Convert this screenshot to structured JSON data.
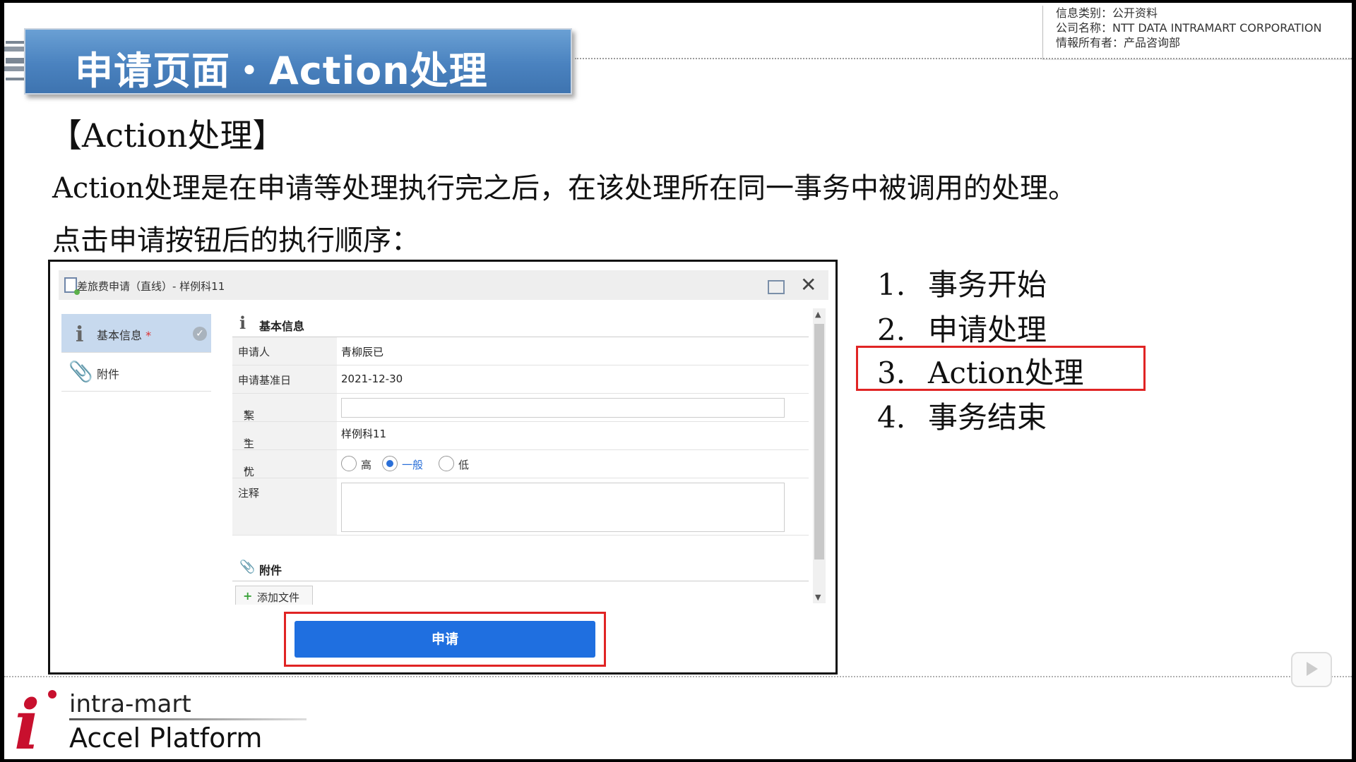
{
  "header": {
    "title": "申请页面・Action处理"
  },
  "info": {
    "line1": "信息类别：公开资料",
    "line2": "公司名称：NTT DATA INTRAMART CORPORATION",
    "line3": "情報所有者：产品咨询部"
  },
  "content": {
    "section_title": "【Action处理】",
    "para1": "Action处理是在申请等处理执行完之后，在该处理所在同一事务中被调用的处理。",
    "para2": "点击申请按钮后的执行顺序："
  },
  "dialog": {
    "title": "差旅费申请（直线）- 样例科11",
    "nav": [
      {
        "label": "基本信息",
        "required": "*"
      },
      {
        "label": "附件"
      }
    ],
    "basic_section": "基本信息",
    "fields": {
      "applicant_label": "申请人",
      "applicant_value": "青柳辰已",
      "base_date_label": "申请基准日",
      "base_date_value": "2021-12-30",
      "case_label": "案件名",
      "org_label": "主管组织",
      "org_value": "样例科11",
      "priority_label": "优先级",
      "priority_options": [
        "高",
        "一般",
        "低"
      ],
      "priority_selected": "一般",
      "note_label": "注释"
    },
    "attach_section": "附件",
    "add_file": "添加文件",
    "apply_button": "申请"
  },
  "steps": [
    {
      "num": "1.",
      "text": "事务开始"
    },
    {
      "num": "2.",
      "text": "申请处理"
    },
    {
      "num": "3.",
      "text": "Action处理"
    },
    {
      "num": "4.",
      "text": "事务结束"
    }
  ],
  "footer": {
    "logo_line1": "intra-mart",
    "logo_line2": "Accel Platform"
  },
  "colors": {
    "banner": "#4a82bf",
    "highlight": "#e02424",
    "button": "#1f6fe0"
  }
}
